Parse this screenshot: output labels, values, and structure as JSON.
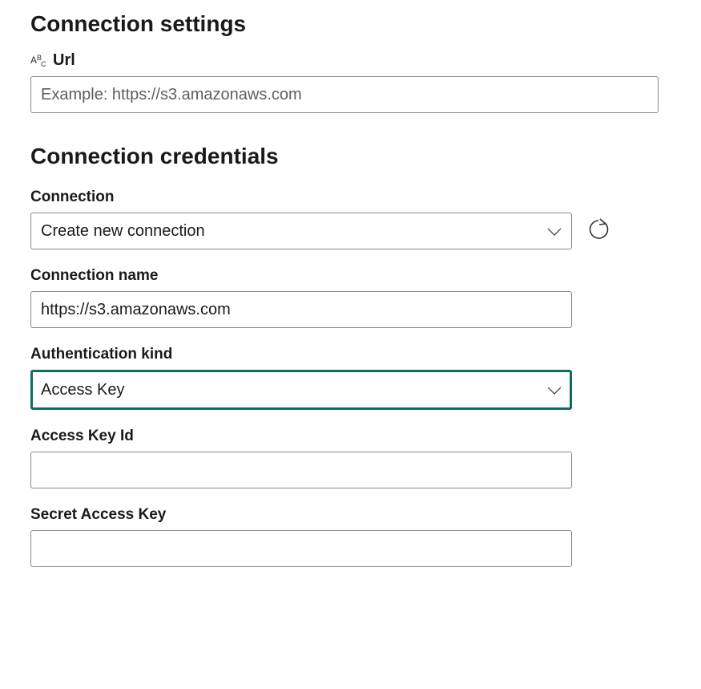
{
  "settings": {
    "title": "Connection settings",
    "url_label": "Url",
    "url_placeholder": "Example: https://s3.amazonaws.com",
    "url_value": ""
  },
  "credentials": {
    "title": "Connection credentials",
    "connection_label": "Connection",
    "connection_selected": "Create new connection",
    "connection_name_label": "Connection name",
    "connection_name_value": "https://s3.amazonaws.com",
    "auth_kind_label": "Authentication kind",
    "auth_kind_selected": "Access Key",
    "access_key_id_label": "Access Key Id",
    "access_key_id_value": "",
    "secret_access_key_label": "Secret Access Key",
    "secret_access_key_value": ""
  },
  "icons": {
    "abc": "abc-icon",
    "chevron_down": "chevron-down-icon",
    "refresh": "refresh-icon"
  }
}
